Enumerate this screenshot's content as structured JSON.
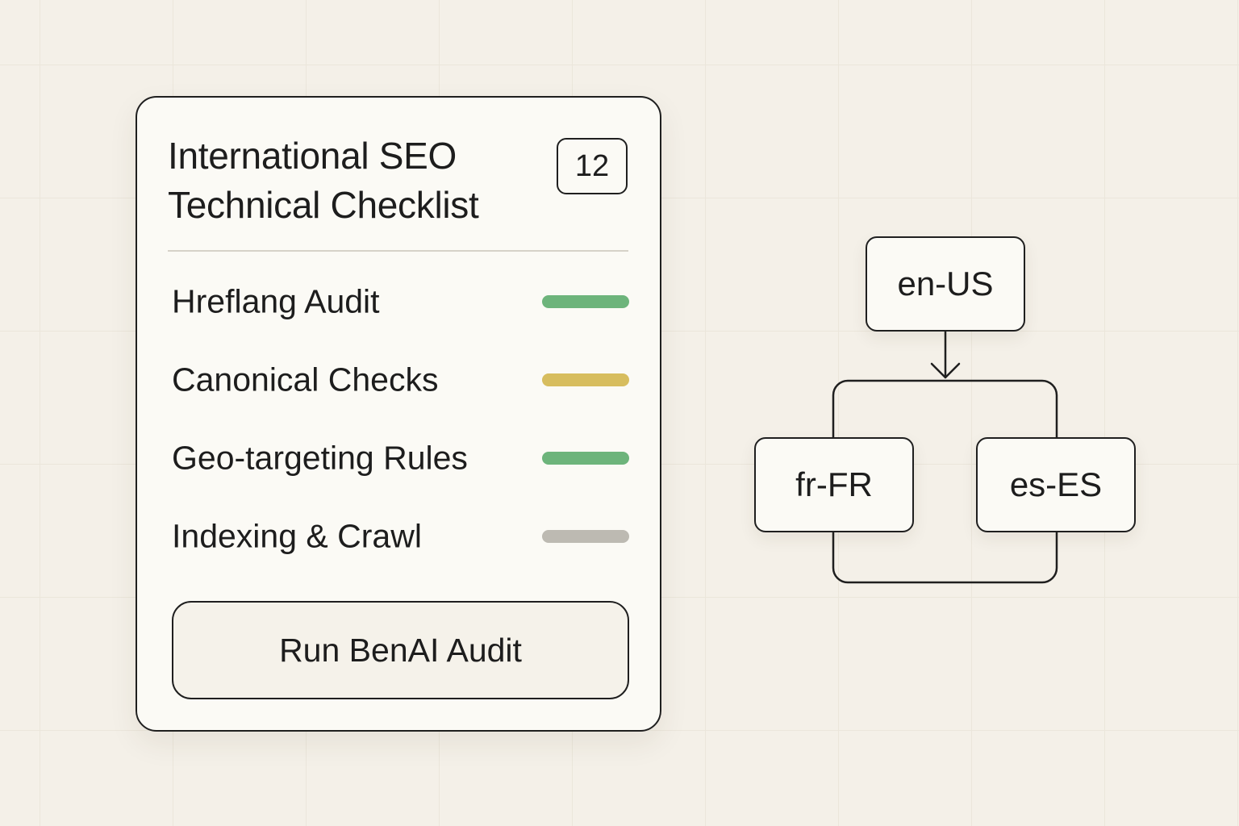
{
  "checklist": {
    "title": "International SEO Technical Checklist",
    "badge_count": "12",
    "items": [
      {
        "label": "Hreflang Audit",
        "status_color": "#6db47b"
      },
      {
        "label": "Canonical Checks",
        "status_color": "#d7bd5e"
      },
      {
        "label": "Geo-targeting Rules",
        "status_color": "#6db47b"
      },
      {
        "label": "Indexing & Crawl",
        "status_color": "#bdbab2"
      }
    ],
    "action_label": "Run BenAI Audit"
  },
  "locale_diagram": {
    "root": "en-US",
    "children": [
      "fr-FR",
      "es-ES"
    ]
  }
}
